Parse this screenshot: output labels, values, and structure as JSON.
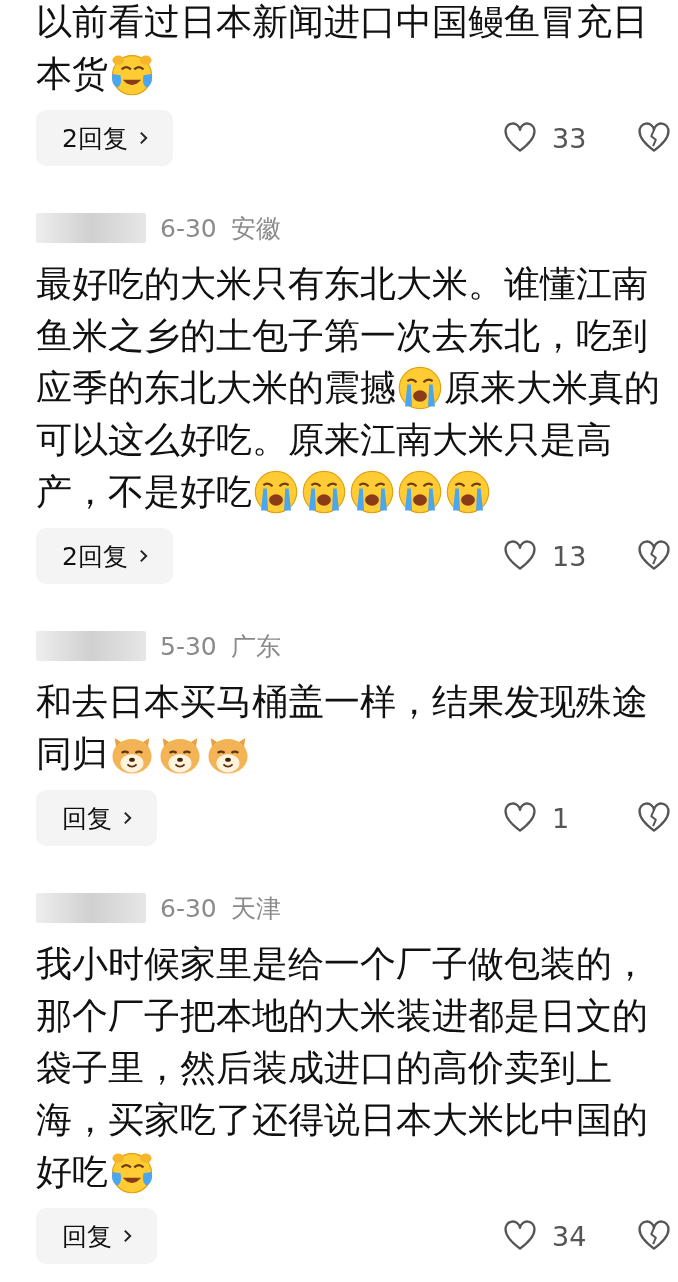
{
  "comments": [
    {
      "lines": [
        [
          {
            "kind": "text",
            "text": "以前看过日本新闻进口中国鳗鱼冒充日"
          }
        ],
        [
          {
            "kind": "text",
            "text": "本货"
          },
          {
            "kind": "laugh-cry"
          }
        ]
      ],
      "reply_button": "2回复",
      "likes": "33"
    },
    {
      "redacted_name": true,
      "date": "6-30",
      "region": "安徽",
      "lines": [
        [
          {
            "kind": "text",
            "text": "最好吃的大米只有东北大米。谁懂江南"
          }
        ],
        [
          {
            "kind": "text",
            "text": "鱼米之乡的土包子第一次去东北，吃到"
          }
        ],
        [
          {
            "kind": "text",
            "text": "应季的东北大米的震撼"
          },
          {
            "kind": "crying"
          },
          {
            "kind": "text",
            "text": "原来大米真的"
          }
        ],
        [
          {
            "kind": "text",
            "text": "可以这么好吃。原来江南大米只是高"
          }
        ],
        [
          {
            "kind": "text",
            "text": "产，不是好吃"
          },
          {
            "kind": "crying"
          },
          {
            "kind": "crying"
          },
          {
            "kind": "crying"
          },
          {
            "kind": "crying"
          },
          {
            "kind": "crying"
          }
        ]
      ],
      "reply_button": "2回复",
      "likes": "13"
    },
    {
      "redacted_name": true,
      "date": "5-30",
      "region": "广东",
      "lines": [
        [
          {
            "kind": "text",
            "text": "和去日本买马桶盖一样，结果发现殊途"
          }
        ],
        [
          {
            "kind": "text",
            "text": "同归"
          },
          {
            "kind": "dog"
          },
          {
            "kind": "dog"
          },
          {
            "kind": "dog"
          }
        ]
      ],
      "reply_button": "回复",
      "likes": "1"
    },
    {
      "redacted_name": true,
      "date": "6-30",
      "region": "天津",
      "lines": [
        [
          {
            "kind": "text",
            "text": "我小时候家里是给一个厂子做包装的，"
          }
        ],
        [
          {
            "kind": "text",
            "text": "那个厂子把本地的大米装进都是日文的"
          }
        ],
        [
          {
            "kind": "text",
            "text": "袋子里，然后装成进口的高价卖到上"
          }
        ],
        [
          {
            "kind": "text",
            "text": "海，买家吃了还得说日本大米比中国的"
          }
        ],
        [
          {
            "kind": "text",
            "text": "好吃"
          },
          {
            "kind": "laugh-cry"
          }
        ]
      ],
      "reply_button": "回复",
      "likes": "34"
    }
  ]
}
